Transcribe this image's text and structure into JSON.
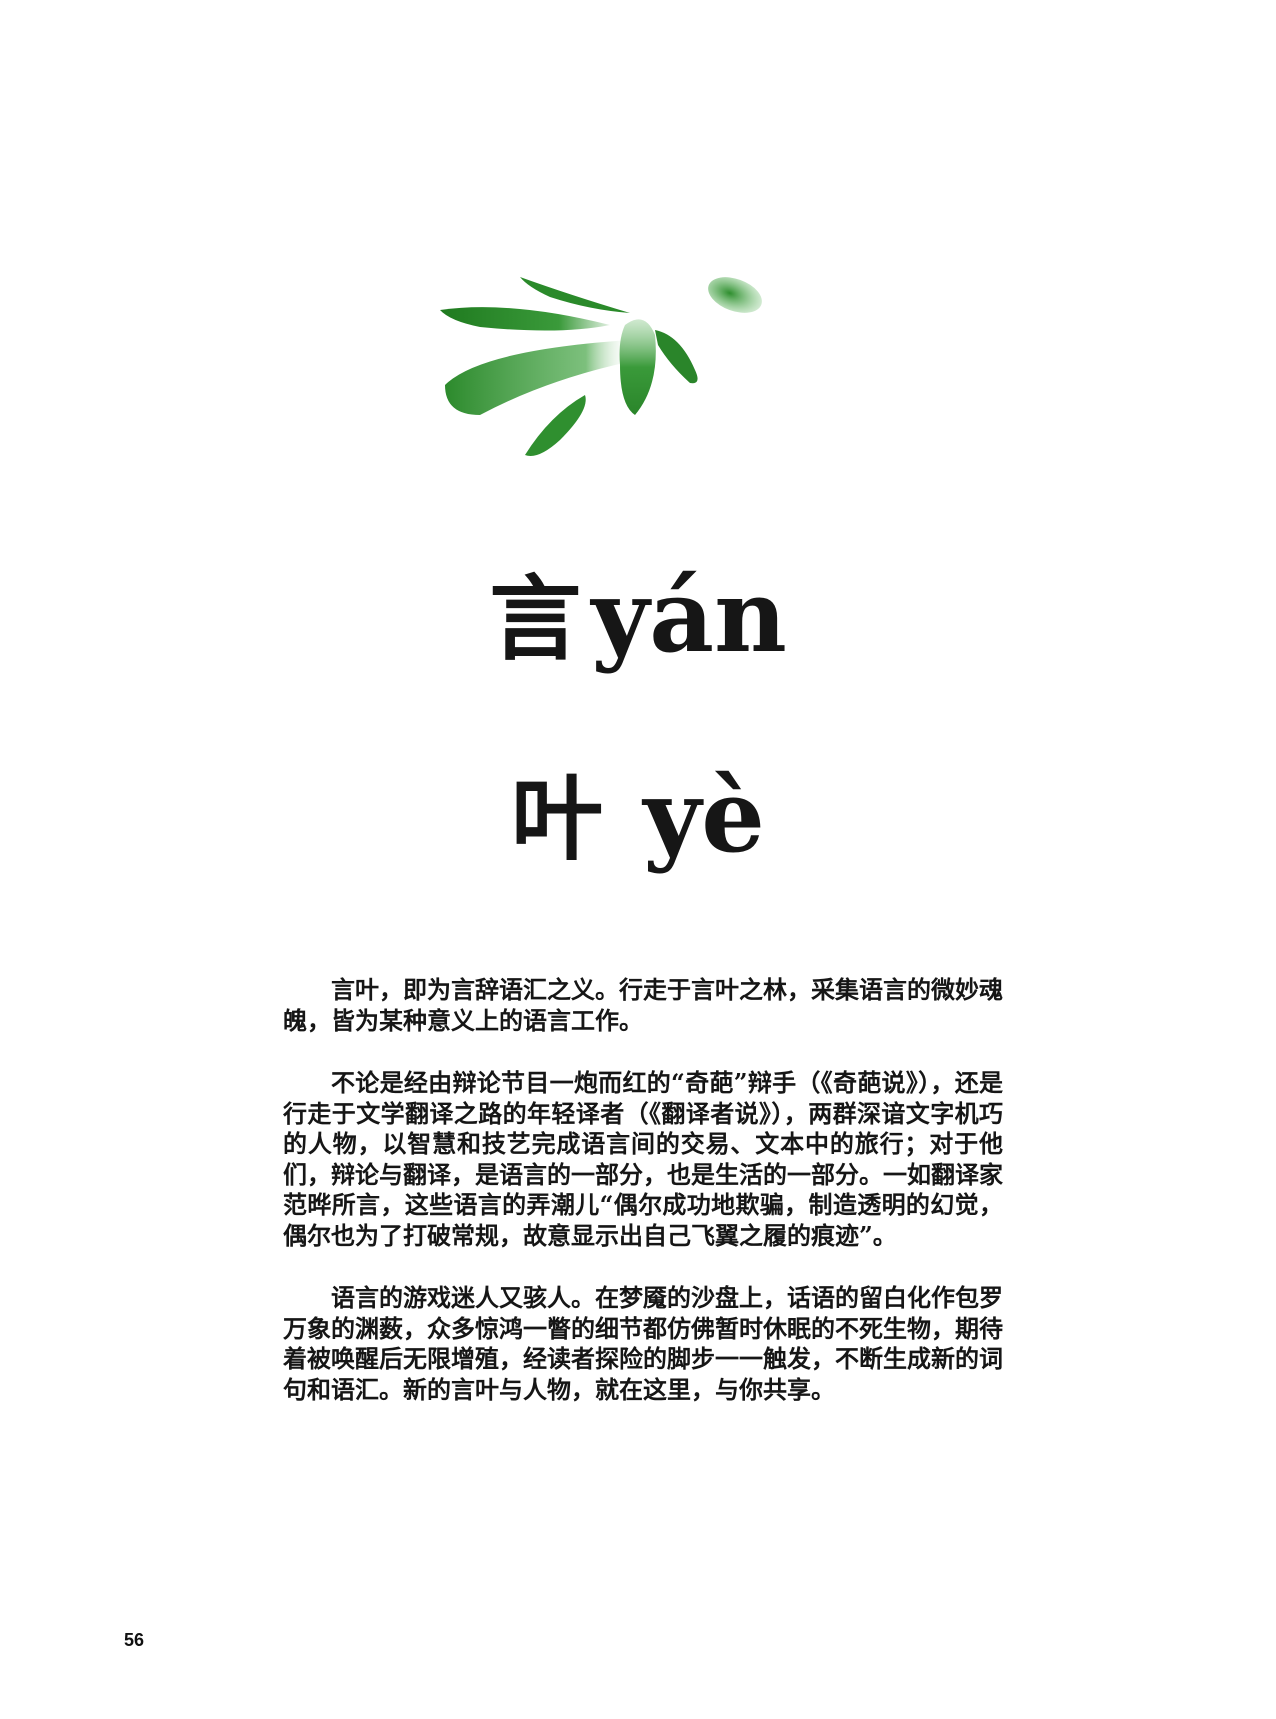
{
  "title": {
    "line1_hanzi": "言",
    "line1_pinyin": "yán",
    "line2_hanzi": "叶",
    "line2_pinyin": "yè"
  },
  "paragraphs": [
    "言叶，即为言辞语汇之义。行走于言叶之林，采集语言的微妙魂魄，皆为某种意义上的语言工作。",
    "不论是经由辩论节目一炮而红的“奇葩”辩手（《奇葩说》），还是行走于文学翻译之路的年轻译者（《翻译者说》），两群深谙文字机巧的人物，以智慧和技艺完成语言间的交易、文本中的旅行；对于他们，辩论与翻译，是语言的一部分，也是生活的一部分。一如翻译家范晔所言，这些语言的弄潮儿“偶尔成功地欺骗，制造透明的幻觉，偶尔也为了打破常规，故意显示出自己飞翼之履的痕迹”。",
    "语言的游戏迷人又骇人。在梦魇的沙盘上，话语的留白化作包罗万象的渊薮，众多惊鸿一瞥的细节都仿佛暂时休眠的不死生物，期待着被唤醒后无限增殖，经读者探险的脚步一一触发，不断生成新的词句和语汇。新的言叶与人物，就在这里，与你共享。"
  ],
  "page_number": "56",
  "colors": {
    "leaf_green": "#2f8f2f",
    "leaf_dark": "#1f6f1f",
    "text": "#161616"
  },
  "icons": {
    "decoration": "ink-brush-leaves"
  }
}
